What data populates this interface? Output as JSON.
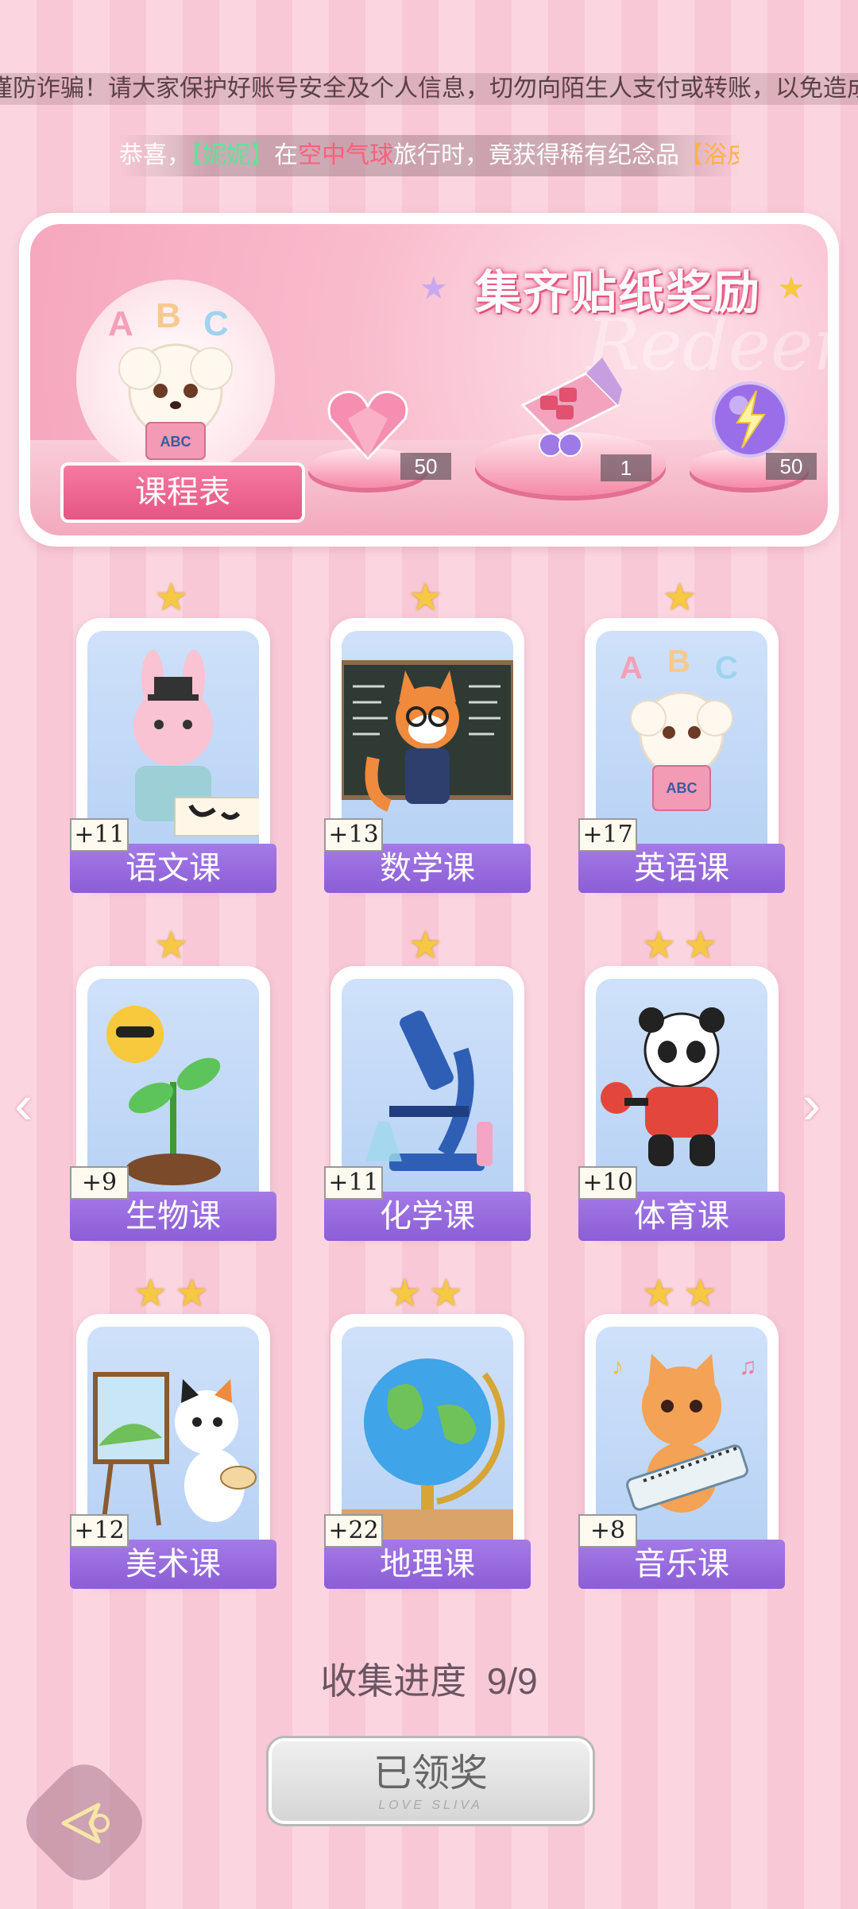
{
  "notice": "谨防诈骗！请大家保护好账号安全及个人信息，切勿向陌生人支付或转账，以免造成财产损失！",
  "ticker": {
    "prefix": "恭喜，",
    "name": "【妮妮】",
    "mid": "在",
    "place": "空中气球",
    "action": "旅行时，竟获得稀有纪念品",
    "item": "【浴皮"
  },
  "banner": {
    "title": "集齐贴纸奖励",
    "schedule_label": "课程表",
    "rewards": [
      {
        "icon": "pink-heart-gem-icon",
        "count": "50"
      },
      {
        "icon": "gift-box-icon",
        "count": "1"
      },
      {
        "icon": "purple-lightning-orb-icon",
        "count": "50"
      }
    ]
  },
  "courses": [
    {
      "name": "语文课",
      "count": "+11",
      "stars": 1,
      "icon": "bunny-calligraphy-icon"
    },
    {
      "name": "数学课",
      "count": "+13",
      "stars": 1,
      "icon": "fox-teacher-icon"
    },
    {
      "name": "英语课",
      "count": "+17",
      "stars": 1,
      "icon": "puppy-abc-book-icon"
    },
    {
      "name": "生物课",
      "count": "+9",
      "stars": 1,
      "icon": "sun-sprout-icon"
    },
    {
      "name": "化学课",
      "count": "+11",
      "stars": 1,
      "icon": "microscope-icon"
    },
    {
      "name": "体育课",
      "count": "+10",
      "stars": 2,
      "icon": "panda-pingpong-icon"
    },
    {
      "name": "美术课",
      "count": "+12",
      "stars": 2,
      "icon": "cat-painter-icon"
    },
    {
      "name": "地理课",
      "count": "+22",
      "stars": 2,
      "icon": "globe-icon"
    },
    {
      "name": "音乐课",
      "count": "+8",
      "stars": 2,
      "icon": "cat-keyboard-icon"
    }
  ],
  "progress": {
    "label": "收集进度",
    "value": "9/9"
  },
  "claim_button": {
    "label": "已领奖",
    "sub": "LOVE SLIVA"
  }
}
